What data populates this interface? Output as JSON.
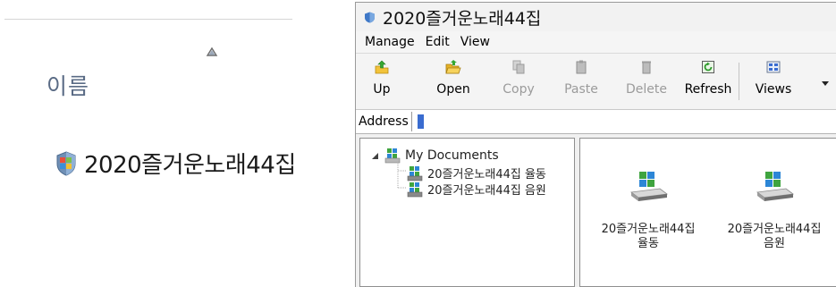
{
  "left_panel": {
    "column_header": "이름",
    "item_label": "2020즐거운노래44집"
  },
  "window": {
    "title": "2020즐거운노래44집"
  },
  "menu": [
    "Manage",
    "Edit",
    "View"
  ],
  "toolbar": {
    "buttons": [
      {
        "label": "Up",
        "icon": "up-folder-icon",
        "enabled": true
      },
      {
        "label": "Open",
        "icon": "open-folder-icon",
        "enabled": true
      },
      {
        "label": "Copy",
        "icon": "copy-icon",
        "enabled": false
      },
      {
        "label": "Paste",
        "icon": "paste-icon",
        "enabled": false
      },
      {
        "label": "Delete",
        "icon": "delete-icon",
        "enabled": false
      },
      {
        "label": "Refresh",
        "icon": "refresh-icon",
        "enabled": true
      },
      {
        "label": "Views",
        "icon": "views-icon",
        "enabled": true
      }
    ]
  },
  "address": {
    "label": "Address",
    "value": ""
  },
  "tree": {
    "root": "My Documents",
    "children": [
      "20즐거운노래44집 율동",
      "20즐거운노래44집 음원"
    ]
  },
  "content": {
    "items": [
      {
        "line1": "20즐거운노래44집",
        "line2": "율동"
      },
      {
        "line1": "20즐거운노래44집",
        "line2": "음원"
      }
    ]
  },
  "colors": {
    "accent_blue": "#3a6cd0",
    "disabled_text": "#9b9b9b",
    "folder_green": "#3fa43f",
    "drive_blue": "#2d86d6"
  }
}
